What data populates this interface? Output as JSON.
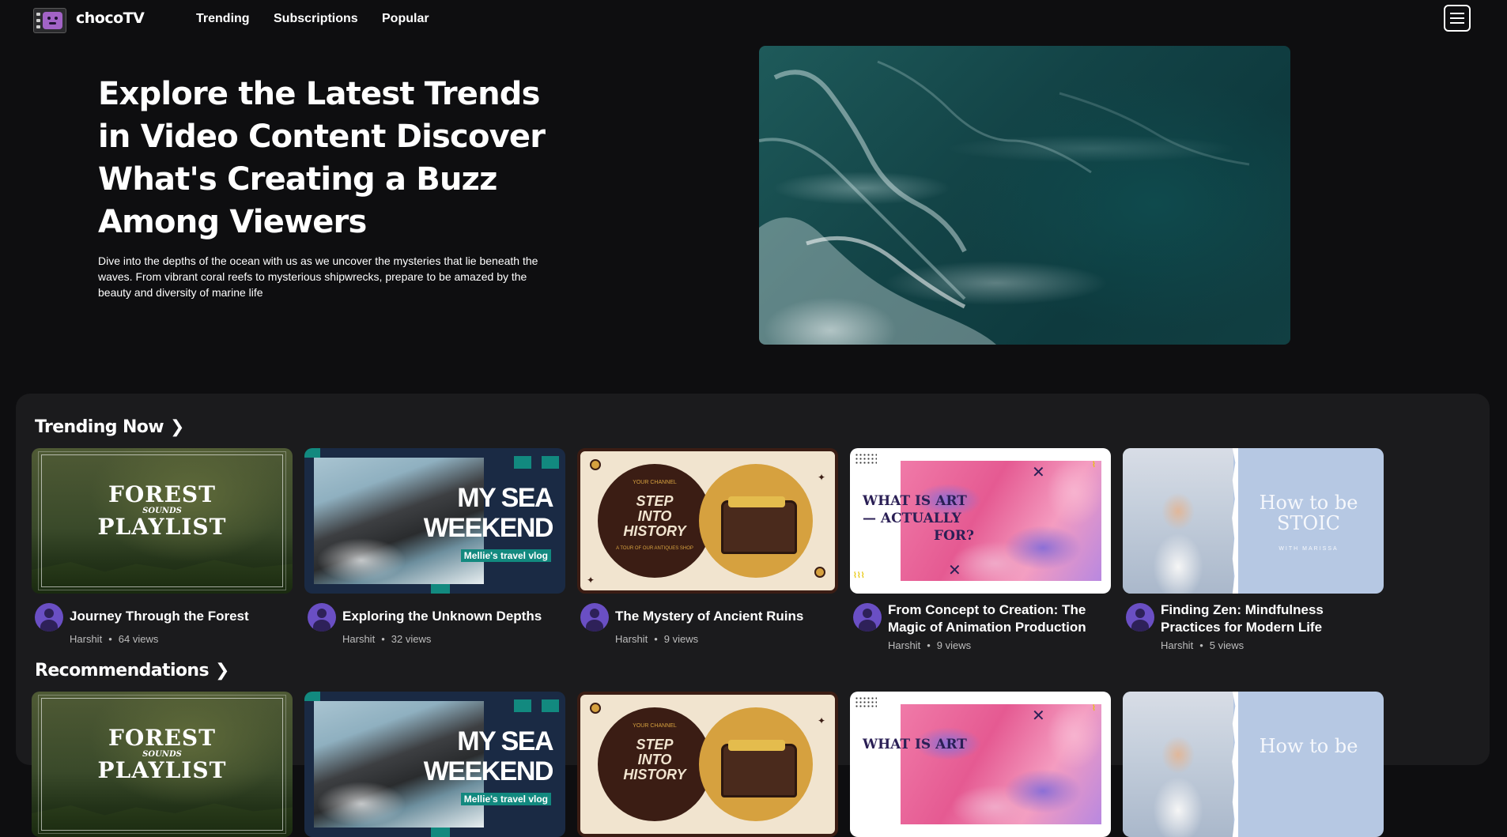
{
  "app": {
    "name": "chocoTV"
  },
  "nav": {
    "links": [
      "Trending",
      "Subscriptions",
      "Popular"
    ]
  },
  "hero": {
    "title": "Explore the Latest Trends in Video Content Discover What's Creating a Buzz Among Viewers",
    "description": "Dive into the depths of the ocean with us as we uncover the mysteries that lie beneath the waves. From vibrant coral reefs to mysterious shipwrecks, prepare to be amazed by the beauty and diversity of marine life"
  },
  "sections": {
    "trending": {
      "title": "Trending Now"
    },
    "recommendations": {
      "title": "Recommendations"
    }
  },
  "thumbs": {
    "forest": {
      "line1": "FOREST",
      "line2": "SOUNDS",
      "line3": "PLAYLIST"
    },
    "sea": {
      "line1": "MY SEA",
      "line2": "WEEKEND",
      "tag": "Mellie's travel vlog"
    },
    "ruins": {
      "top": "YOUR CHANNEL",
      "line1": "STEP",
      "line2": "INTO",
      "line3": "HISTORY",
      "bottom": "A TOUR OF OUR ANTIQUES SHOP"
    },
    "art": {
      "line1": "WHAT IS ART",
      "line2": "— ACTUALLY",
      "line3": "FOR?"
    },
    "stoic": {
      "line1": "How to be",
      "line2": "STOIC",
      "with": "WITH MARISSA"
    }
  },
  "trending_videos": [
    {
      "title": "Journey Through the Forest",
      "channel": "Harshit",
      "views": "64 views"
    },
    {
      "title": "Exploring the Unknown Depths",
      "channel": "Harshit",
      "views": "32 views"
    },
    {
      "title": "The Mystery of Ancient Ruins",
      "channel": "Harshit",
      "views": "9 views"
    },
    {
      "title": "From Concept to Creation: The Magic of Animation Production",
      "channel": "Harshit",
      "views": "9 views"
    },
    {
      "title": "Finding Zen: Mindfulness Practices for Modern Life",
      "channel": "Harshit",
      "views": "5 views"
    }
  ],
  "icons": {
    "menu": "hamburger-menu-icon",
    "chevron": "chevron-right-icon",
    "avatar": "user-avatar-icon"
  },
  "colors": {
    "background": "#0e0e10",
    "panel": "#1b1b1d",
    "avatar": "#6a4fc4"
  }
}
